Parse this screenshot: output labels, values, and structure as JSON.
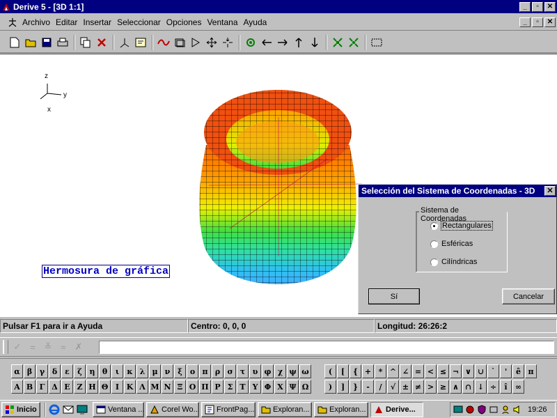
{
  "window": {
    "title": "Derive 5 - [3D 1:1]",
    "min": "_",
    "restore": "▫",
    "close": "✕"
  },
  "menu": {
    "items": [
      "Archivo",
      "Editar",
      "Insertar",
      "Seleccionar",
      "Opciones",
      "Ventana",
      "Ayuda"
    ]
  },
  "toolbar": {
    "icons": [
      "new-file-icon",
      "open-folder-icon",
      "save-icon",
      "print-icon",
      "copy-icon",
      "delete-icon",
      "axes-icon",
      "label-icon",
      "plot-icon",
      "window-icon",
      "play-icon",
      "move-icon",
      "center-icon",
      "rotate-icon",
      "left-arrow-icon",
      "right-arrow-icon",
      "up-arrow-icon",
      "down-arrow-icon",
      "zoom-in-icon",
      "zoom-out-icon",
      "grid-icon"
    ]
  },
  "plot": {
    "axes": {
      "z": "z",
      "y": "y",
      "x": "x"
    },
    "label": "Hermosura de gráfica"
  },
  "dialog": {
    "title": "Selección del Sistema de Coordenadas - 3D",
    "close": "✕",
    "group_label": "Sistema de Coordenadas",
    "options": [
      {
        "label": "Rectangulares",
        "checked": true
      },
      {
        "label": "Esféricas",
        "checked": false
      },
      {
        "label": "Cilíndricas",
        "checked": false
      }
    ],
    "ok": "Sí",
    "cancel": "Cancelar"
  },
  "status": {
    "help": "Pulsar F1 para ir a Ayuda",
    "center": "Centro: 0, 0, 0",
    "longitude": "Longitud: 26:26:2"
  },
  "entry": {
    "buttons": [
      "✓",
      "=",
      "≚",
      "≈",
      "✗"
    ],
    "value": ""
  },
  "greek": {
    "lower": [
      "α",
      "β",
      "γ",
      "δ",
      "ε",
      "ζ",
      "η",
      "θ",
      "ι",
      "κ",
      "λ",
      "μ",
      "ν",
      "ξ",
      "ο",
      "π",
      "ρ",
      "σ",
      "τ",
      "υ",
      "φ",
      "χ",
      "ψ",
      "ω"
    ],
    "upper": [
      "Α",
      "Β",
      "Γ",
      "Δ",
      "Ε",
      "Ζ",
      "Η",
      "Θ",
      "Ι",
      "Κ",
      "Λ",
      "Μ",
      "Ν",
      "Ξ",
      "Ο",
      "Π",
      "Ρ",
      "Σ",
      "Τ",
      "Υ",
      "Φ",
      "Χ",
      "Ψ",
      "Ω"
    ]
  },
  "symbols": {
    "row1": [
      "(",
      "[",
      "{",
      "+",
      "*",
      "^",
      "∠",
      "=",
      "<",
      "≤",
      "¬",
      "∨",
      "∪",
      "`",
      "'",
      "ê",
      "π"
    ],
    "row2": [
      ")",
      "]",
      "}",
      "-",
      "/",
      "√",
      "±",
      "≠",
      ">",
      "≥",
      "∧",
      "∩",
      "↓",
      "÷",
      "î",
      "∞"
    ]
  },
  "taskbar": {
    "start": "Inicio",
    "tasks": [
      "Ventana ...",
      "Corel Wo...",
      "FrontPag...",
      "Exploran...",
      "Exploran...",
      "Derive..."
    ],
    "clock": "19:26"
  },
  "colors": {
    "titlebar": "#000080",
    "face": "#c0c0c0",
    "plotlabel": "#0000c0"
  }
}
